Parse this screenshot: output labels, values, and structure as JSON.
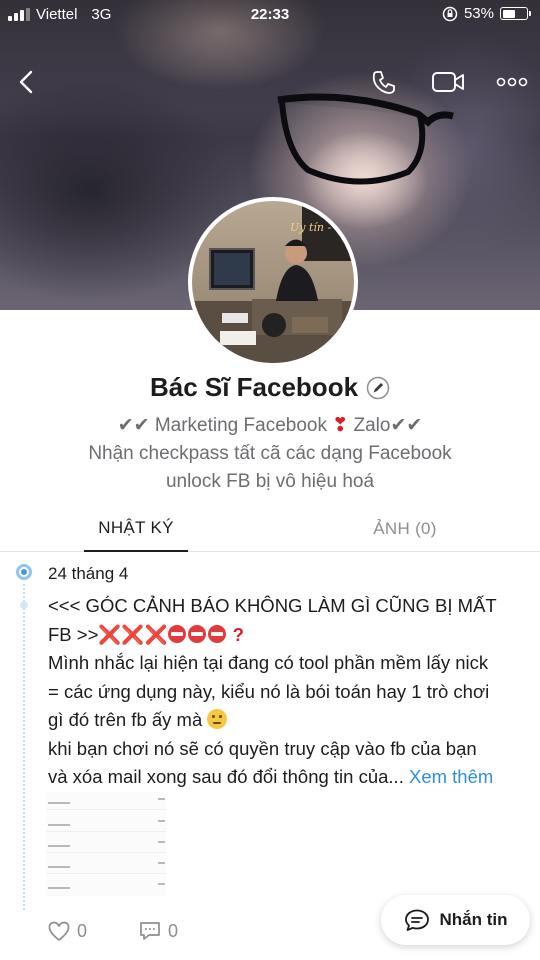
{
  "status_bar": {
    "carrier": "Viettel",
    "network": "3G",
    "time": "22:33",
    "battery": "53%",
    "battery_level": 0.53,
    "signal_bars": 3
  },
  "nav": {
    "back_icon": "chevron-left-icon",
    "call_icon": "phone-icon",
    "video_icon": "video-camera-icon",
    "more_icon": "more-dots-icon"
  },
  "profile": {
    "name": "Bác Sĩ Facebook",
    "edit_icon": "pencil-icon",
    "bio_line1_a": "Marketing Facebook",
    "bio_line1_b": "Zalo",
    "bio_line2": "Nhận checkpass tất cã các dạng Facebook",
    "bio_line3": "unlock FB bị vô hiệu hoá"
  },
  "tabs": [
    {
      "label": "NHẬT KÝ",
      "active": true
    },
    {
      "label": "ẢNH (0)",
      "active": false
    }
  ],
  "post": {
    "date": "24 tháng 4",
    "line1": "<<< GÓC CẢNH BÁO KHÔNG LÀM GÌ CŨNG BỊ MẤT",
    "line2_prefix": "FB >>",
    "line2_marks": "❌❌❌",
    "line2_question": "?",
    "line3": "Mình nhắc lại hiện tại đang có tool phần mềm lấy nick",
    "line4": "= các ứng dụng này, kiểu nó là bói toán hay 1 trò chơi",
    "line5": "gì đó trên fb ấy mà",
    "line6": "khi bạn chơi nó sẽ có quyền truy cập vào fb của bạn",
    "line7": "và xóa mail xong sau đó đổi thông tin của...",
    "see_more": "Xem thêm",
    "likes": "0",
    "comments": "0"
  },
  "chat_button": {
    "label": "Nhắn tin",
    "icon": "chat-bubble-icon"
  },
  "colors": {
    "link": "#2f8fdc",
    "timeline": "#3c9be5",
    "muted": "#6d6d72",
    "warning_red": "#d71f26"
  }
}
